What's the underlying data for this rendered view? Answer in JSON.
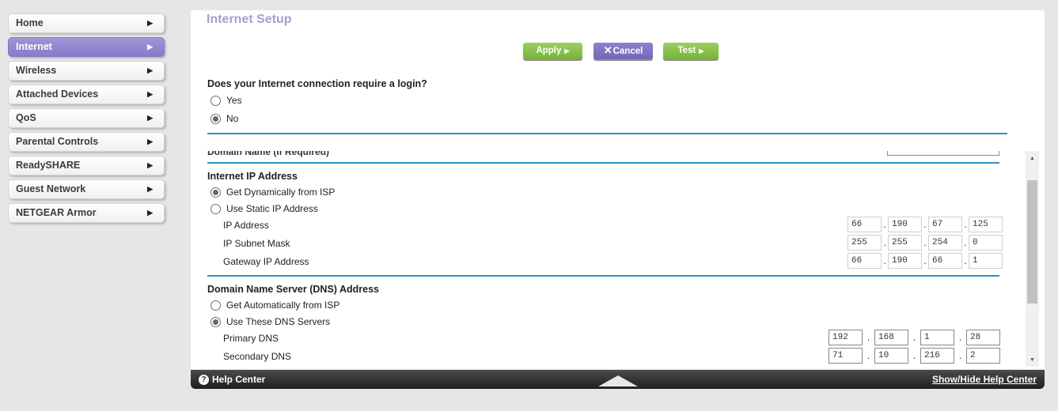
{
  "sidebar": {
    "items": [
      {
        "label": "Home"
      },
      {
        "label": "Internet"
      },
      {
        "label": "Wireless"
      },
      {
        "label": "Attached Devices"
      },
      {
        "label": "QoS"
      },
      {
        "label": "Parental Controls"
      },
      {
        "label": "ReadySHARE"
      },
      {
        "label": "Guest Network"
      },
      {
        "label": "NETGEAR Armor"
      }
    ],
    "arrow_icon": "triangle-right-icon",
    "active_index": 1,
    "active_color": "#8a79c9"
  },
  "page": {
    "title": "Internet Setup",
    "title_color": "#a99dd1"
  },
  "toolbar": {
    "apply_label": "Apply",
    "cancel_label": "Cancel",
    "test_label": "Test",
    "apply_color": "#77b23a",
    "cancel_color": "#7465b8"
  },
  "login": {
    "question": "Does your Internet connection require a login?",
    "yes_label": "Yes",
    "no_label": "No",
    "selected": "No"
  },
  "domain_name": {
    "label": "Domain Name  (If Required)",
    "value": ""
  },
  "ip_section": {
    "title": "Internet IP Address",
    "dynamic_label": "Get Dynamically from ISP",
    "static_label": "Use Static IP Address",
    "selected": "Get Dynamically from ISP",
    "ip_address": {
      "label": "IP Address",
      "octets": [
        "66",
        "190",
        "67",
        "125"
      ]
    },
    "subnet_mask": {
      "label": "IP Subnet Mask",
      "octets": [
        "255",
        "255",
        "254",
        "0"
      ]
    },
    "gateway": {
      "label": "Gateway IP Address",
      "octets": [
        "66",
        "190",
        "66",
        "1"
      ]
    }
  },
  "dns_section": {
    "title": "Domain Name Server (DNS) Address",
    "auto_label": "Get Automatically from ISP",
    "manual_label": "Use These DNS Servers",
    "selected": "Use These DNS Servers",
    "primary": {
      "label": "Primary DNS",
      "octets": [
        "192",
        "168",
        "1",
        "28"
      ]
    },
    "secondary": {
      "label": "Secondary DNS",
      "octets": [
        "71",
        "10",
        "216",
        "2"
      ]
    }
  },
  "helpbar": {
    "help_label": "Help Center",
    "toggle_label": "Show/Hide Help Center",
    "help_icon": "question-circle-icon",
    "expand_icon": "triangle-up-icon"
  },
  "colors": {
    "divider": "#3391c6"
  }
}
